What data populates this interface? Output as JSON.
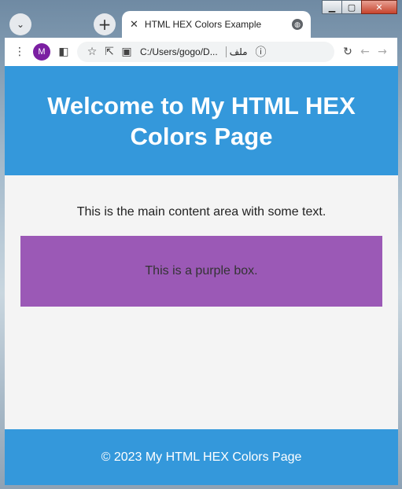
{
  "window": {
    "minimize_icon": "minimize-icon",
    "maximize_icon": "maximize-icon",
    "close_icon": "close-icon"
  },
  "tab": {
    "title": "HTML HEX Colors Example"
  },
  "toolbar": {
    "profile_initial": "M",
    "url": "C:/Users/gogo/D...",
    "rtl_label": "ملف"
  },
  "page": {
    "header_title": "Welcome to My HTML HEX Colors Page",
    "main_text": "This is the main content area with some text.",
    "purple_box_text": "This is a purple box.",
    "footer_text": "© 2023 My HTML HEX Colors Page"
  },
  "colors": {
    "header_bg": "#3498db",
    "page_bg": "#f4f4f4",
    "purple_box": "#9b59b6",
    "footer_bg": "#3498db"
  }
}
